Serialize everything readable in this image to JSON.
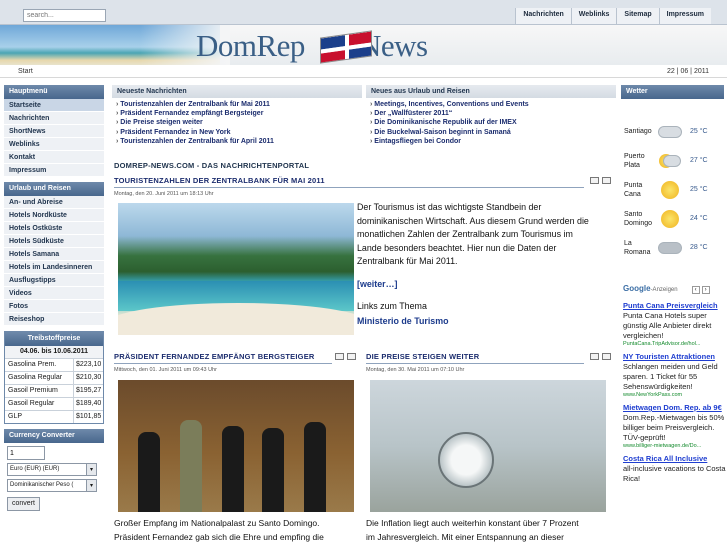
{
  "header": {
    "search_placeholder": "search...",
    "nav": [
      "Nachrichten",
      "Weblinks",
      "Sitemap",
      "Impressum"
    ]
  },
  "logo": {
    "text": "DomRep",
    "text2": "News"
  },
  "breadcrumb": {
    "label": "Start",
    "date": "22 | 06 | 2011"
  },
  "hauptmenu": {
    "title": "Hauptmenü",
    "items": [
      "Startseite",
      "Nachrichten",
      "ShortNews",
      "Weblinks",
      "Kontakt",
      "Impressum"
    ]
  },
  "urlaub_menu": {
    "title": "Urlaub und Reisen",
    "items": [
      "An- und Abreise",
      "Hotels Nordküste",
      "Hotels Ostküste",
      "Hotels Südküste",
      "Hotels Samana",
      "Hotels im Landesinneren",
      "Ausflugstipps",
      "Videos",
      "Fotos",
      "Reiseshop"
    ]
  },
  "fuel": {
    "title": "Treibstoffpreise",
    "date": "04.06. bis 10.06.2011",
    "rows": [
      {
        "name": "Gasolina Prem.",
        "value": "$223,10"
      },
      {
        "name": "Gasolina Regular",
        "value": "$210,30"
      },
      {
        "name": "Gasoil Premium",
        "value": "$195,27"
      },
      {
        "name": "Gasoil Regular",
        "value": "$189,40"
      },
      {
        "name": "GLP",
        "value": "$101,85"
      }
    ]
  },
  "currency": {
    "title": "Currency Converter",
    "amount": "1",
    "from": "Euro (EUR) (EUR)",
    "to": "Dominikanischer Peso (",
    "button": "convert"
  },
  "news_left": {
    "title": "Neueste Nachrichten",
    "items": [
      "Touristenzahlen der Zentralbank für Mai 2011",
      "Präsident Fernandez empfängt Bergsteiger",
      "Die Preise steigen weiter",
      "Präsident Fernandez in New York",
      "Touristenzahlen der Zentralbank für April 2011"
    ]
  },
  "news_right": {
    "title": "Neues aus Urlaub und Reisen",
    "items": [
      "Meetings, Incentives, Conventions und Events",
      "Der „Wallfüsterer 2011“",
      "Die Dominikanische Republik auf der IMEX",
      "Die Buckelwal-Saison beginnt in Samaná",
      "Eintagsfliegen bei Condor"
    ]
  },
  "portal_title": "DOMREP-NEWS.COM - DAS NACHRICHTENPORTAL",
  "article1": {
    "title": "TOURISTENZAHLEN DER ZENTRALBANK FÜR MAI 2011",
    "date": "Montag, den 20. Juni 2011 um 18:13 Uhr",
    "lines": [
      "Der Tourismus ist das wichtigste Standbein der",
      "dominikanischen Wirtschaft. Aus diesem Grund werden die",
      "monatlichen Zahlen der Zentralbank zum Tourismus im",
      "Lande besonders beachtet. Hier nun die Daten der",
      "Zentralbank für Mai 2011."
    ],
    "more": "[weiter…]",
    "links_label": "Links zum Thema",
    "link": "Ministerio de Turismo"
  },
  "article2": {
    "title": "PRÄSIDENT FERNANDEZ EMPFÄNGT BERGSTEIGER",
    "date": "Mittwoch, den 01. Juni 2011 um 09:43 Uhr",
    "lines": [
      "Großer Empfang im Nationalpalast zu Santo Domingo.",
      "Präsident Fernandez gab sich die Ehre und empfing die"
    ]
  },
  "article3": {
    "title": "DIE PREISE STEIGEN WEITER",
    "date": "Montag, den 30. Mai 2011 um 07:10 Uhr",
    "lines": [
      "Die Inflation liegt auch weiterhin konstant über 7 Prozent",
      "im Jahresvergleich. Mit einer Entspannung an dieser"
    ]
  },
  "weather": {
    "title": "Wetter",
    "rows": [
      {
        "city": "Santiago",
        "temp": "25 °C",
        "icon": "cloud"
      },
      {
        "city": "Puerto Plata",
        "temp": "27 °C",
        "icon": "sun-cloud"
      },
      {
        "city": "Punta Cana",
        "temp": "25 °C",
        "icon": "sun"
      },
      {
        "city": "Santo Domingo",
        "temp": "24 °C",
        "icon": "sun"
      },
      {
        "city": "La Romana",
        "temp": "28 °C",
        "icon": "cloud"
      }
    ]
  },
  "ads": {
    "header_brand": "Google",
    "header_label": "-Anzeigen",
    "items": [
      {
        "title": "Punta Cana Preisvergleich",
        "body": "Punta Cana Hotels super günstig Alle Anbieter direkt vergleichen!",
        "url": "PuntaCana.TripAdvisor.de/hol..."
      },
      {
        "title": "NY Touristen Attraktionen",
        "body": "Schlangen meiden und Geld sparen. 1 Ticket für 55 Sehenswürdigkeiten!",
        "url": "www.NewYorkPass.com"
      },
      {
        "title": "Mietwagen Dom. Rep. ab 9€",
        "body": "Dom.Rep.-Mietwagen bis 50% billiger beim Preisvergleich. TÜV-geprüft!",
        "url": "www.billiger-mietwagen.de/Do..."
      },
      {
        "title": "Costa Rica All Inclusive",
        "body": "all-inclusive vacations to Costa Rica!",
        "url": ""
      }
    ]
  }
}
